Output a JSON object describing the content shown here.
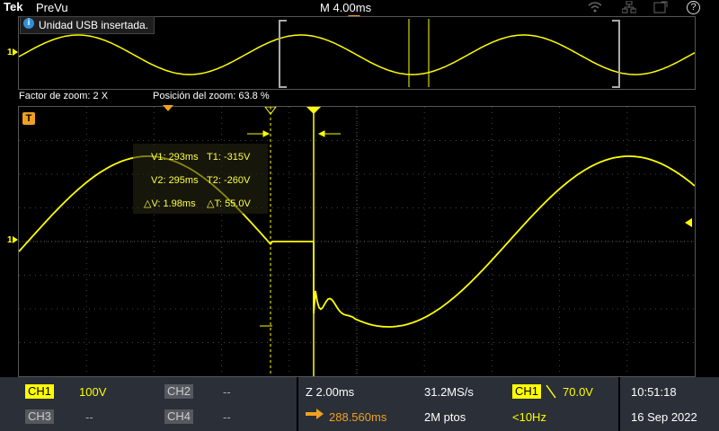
{
  "topbar": {
    "brand": "Tek",
    "mode": "PreVu",
    "timebase": "M 4.00ms"
  },
  "notice": {
    "text": "Unidad USB insertada."
  },
  "zoom": {
    "factor": "Factor de zoom: 2 X",
    "position": "Posición del zoom: 63.8 %"
  },
  "markers": {
    "ch1": "1",
    "trigger": "T"
  },
  "cursors": {
    "v1": "V1: 293ms",
    "t1": "T1: -315V",
    "v2": "V2: 295ms",
    "t2": "T2: -260V",
    "dv": "△V: 1.98ms",
    "dt": "△T: 55.0V"
  },
  "bottom": {
    "ch1_label": "CH1",
    "ch1_scale": "100V",
    "ch2_label": "CH2",
    "ch2_scale": "--",
    "ch3_label": "CH3",
    "ch3_scale": "--",
    "ch4_label": "CH4",
    "ch4_scale": "--",
    "zoom_scale": "Z 2.00ms",
    "delay": "288.560ms",
    "sample_rate": "31.2MS/s",
    "record_length": "2M ptos",
    "trig_source": "CH1",
    "trig_level": "70.0V",
    "trig_freq": "<10Hz",
    "time": "10:51:18",
    "date": "16 Sep 2022"
  },
  "colors": {
    "trace": "#ffff00",
    "accent": "#f0a020",
    "panel": "#2a2f38"
  }
}
